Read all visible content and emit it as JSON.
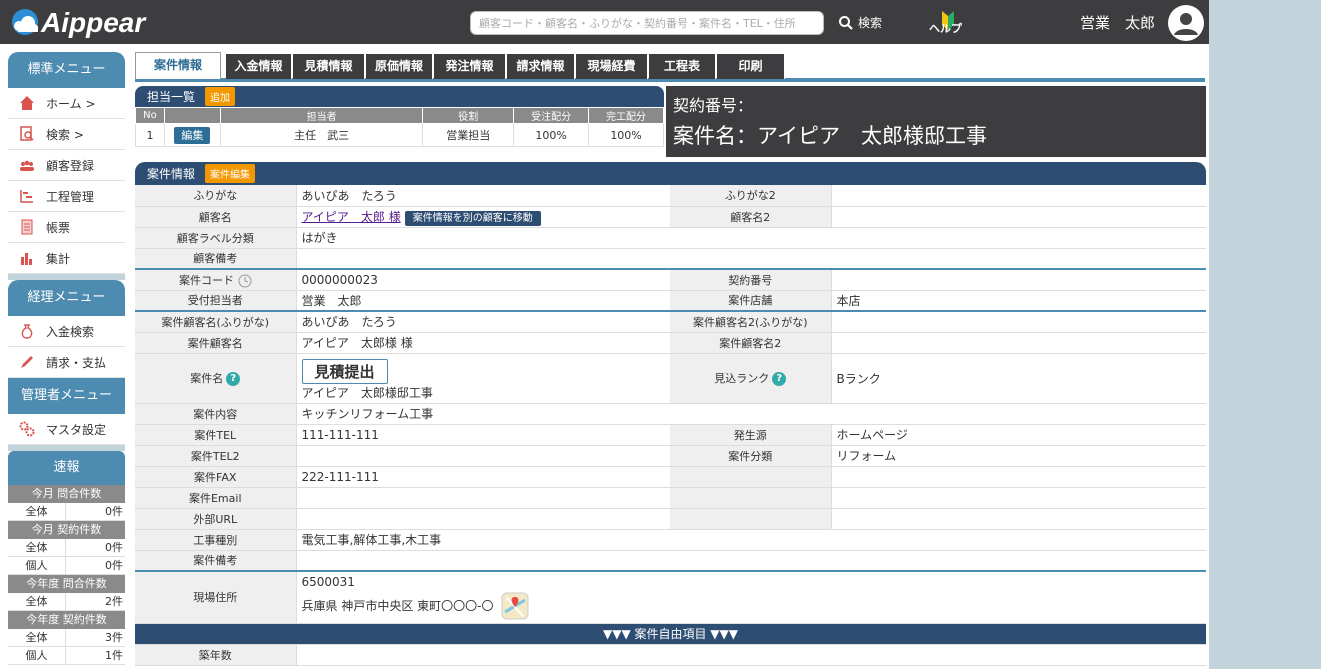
{
  "header": {
    "logo_text": "Aippear",
    "search_placeholder": "顧客コード・顧客名・ふりがな・契約番号・案件名・TEL・住所",
    "search_button": "検索",
    "help_label": "ヘルプ",
    "user_name": "営業　太郎"
  },
  "sidebar": {
    "standard_title": "標準メニュー",
    "standard_items": [
      {
        "label": "ホーム >",
        "icon": "home-icon"
      },
      {
        "label": "検索 >",
        "icon": "search-doc-icon"
      },
      {
        "label": "顧客登録",
        "icon": "people-icon"
      },
      {
        "label": "工程管理",
        "icon": "gantt-icon"
      },
      {
        "label": "帳票",
        "icon": "document-icon"
      },
      {
        "label": "集計",
        "icon": "bar-chart-icon"
      }
    ],
    "accounting_title": "経理メニュー",
    "accounting_items": [
      {
        "label": "入金検索",
        "icon": "money-bag-icon"
      },
      {
        "label": "請求・支払",
        "icon": "pen-icon"
      }
    ],
    "admin_title": "管理者メニュー",
    "admin_items": [
      {
        "label": "マスタ設定",
        "icon": "gears-icon"
      }
    ],
    "report_title": "速報",
    "report_groups": [
      {
        "title": "今月 問合件数",
        "rows": [
          {
            "k": "全体",
            "v": "0件"
          }
        ]
      },
      {
        "title": "今月 契約件数",
        "rows": [
          {
            "k": "全体",
            "v": "0件"
          },
          {
            "k": "個人",
            "v": "0件"
          }
        ]
      },
      {
        "title": "今年度 問合件数",
        "rows": [
          {
            "k": "全体",
            "v": "2件"
          }
        ]
      },
      {
        "title": "今年度 契約件数",
        "rows": [
          {
            "k": "全体",
            "v": "3件"
          },
          {
            "k": "個人",
            "v": "1件"
          }
        ]
      }
    ]
  },
  "tabs": [
    "案件情報",
    "入金情報",
    "見積情報",
    "原価情報",
    "発注情報",
    "請求情報",
    "現場経費",
    "工程表",
    "印刷"
  ],
  "tantou": {
    "title": "担当一覧",
    "add_label": "追加",
    "headers": [
      "No",
      "",
      "担当者",
      "役割",
      "受注配分",
      "完工配分"
    ],
    "rows": [
      {
        "no": "1",
        "edit": "編集",
        "person": "主任　武三",
        "role": "営業担当",
        "order": "100%",
        "complete": "100%"
      }
    ]
  },
  "contract": {
    "number_label": "契約番号：",
    "name_label": "案件名：",
    "name_value": "アイピア　太郎様邸工事"
  },
  "anken": {
    "title": "案件情報",
    "edit_label": "案件編集",
    "furigana_label": "ふりがな",
    "furigana": "あいぴあ　たろう",
    "furigana2_label": "ふりがな2",
    "furigana2": "",
    "customer_label": "顧客名",
    "customer": "アイピア　太郎 様",
    "move_btn": "案件情報を別の顧客に移動",
    "customer2_label": "顧客名2",
    "customer2": "",
    "labelcat_label": "顧客ラベル分類",
    "labelcat": "はがき",
    "note_label": "顧客備考",
    "note": "",
    "code_label": "案件コード",
    "code": "0000000023",
    "contractno_label": "契約番号",
    "contractno": "",
    "reception_label": "受付担当者",
    "reception": "営業　太郎",
    "store_label": "案件店舗",
    "store": "本店",
    "pfuri_label": "案件顧客名(ふりがな)",
    "pfuri": "あいぴあ　たろう",
    "pfuri2_label": "案件顧客名2(ふりがな)",
    "pfuri2": "",
    "pname_label": "案件顧客名",
    "pname": "アイピア　太郎様 様",
    "pname2_label": "案件顧客名2",
    "pname2": "",
    "aname_label": "案件名",
    "estimate_btn": "見積提出",
    "aname": "アイピア　太郎様邸工事",
    "rank_label": "見込ランク",
    "rank": "Bランク",
    "content_label": "案件内容",
    "content": "キッチンリフォーム工事",
    "tel_label": "案件TEL",
    "tel": "111-111-111",
    "source_label": "発生源",
    "source": "ホームページ",
    "tel2_label": "案件TEL2",
    "tel2": "",
    "category_label": "案件分類",
    "category": "リフォーム",
    "fax_label": "案件FAX",
    "fax": "222-111-111",
    "email_label": "案件Email",
    "email": "",
    "url_label": "外部URL",
    "url": "",
    "worktype_label": "工事種別",
    "worktype": "電気工事,解体工事,木工事",
    "anote_label": "案件備考",
    "anote": "",
    "site_label": "現場住所",
    "zip": "6500031",
    "address": "兵庫県 神戸市中央区 東町〇〇〇-〇",
    "free_title": "▼▼▼ 案件自由項目 ▼▼▼",
    "age_label": "築年数",
    "age": ""
  }
}
